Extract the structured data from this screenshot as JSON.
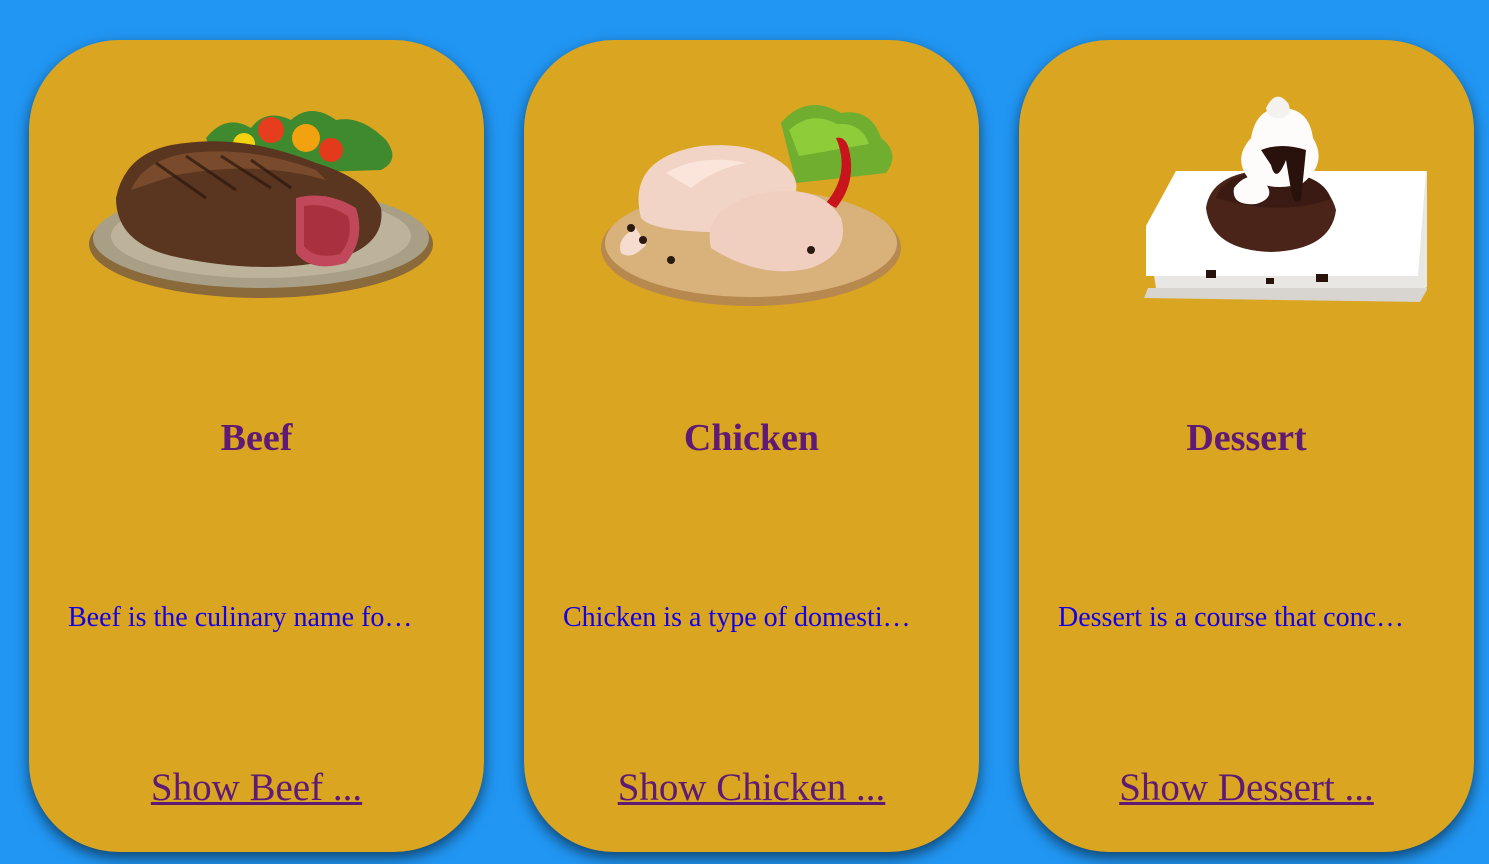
{
  "colors": {
    "page_background": "#2196F3",
    "card_background": "#DAA520",
    "title_color": "#5E1A74",
    "description_color": "#1500E6",
    "link_color": "#5E1A74"
  },
  "categories": [
    {
      "title": "Beef",
      "description": "Beef is the culinary name fo…",
      "link": "Show Beef ...",
      "image": "beef-steak-plate"
    },
    {
      "title": "Chicken",
      "description": "Chicken is a type of domesti…",
      "link": "Show Chicken ...",
      "image": "raw-chicken-board"
    },
    {
      "title": "Dessert",
      "description": "Dessert is a course that conc…",
      "link": "Show Dessert ...",
      "image": "chocolate-lava-cake"
    }
  ]
}
